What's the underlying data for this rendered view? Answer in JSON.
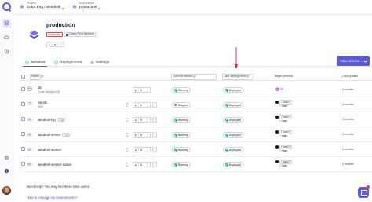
{
  "sidebar": {
    "logo_icon": "qovery-logo-icon",
    "icons": [
      "layers-icon",
      "cloud-icon",
      "history-icon",
      "gear-icon",
      "info-icon"
    ]
  },
  "topbar": {
    "project_caption": "Project",
    "project_value": "Data Eng / Windmill",
    "environment_caption": "Environment",
    "environment_value": "production"
  },
  "environment": {
    "title": "production",
    "mode_tag": "Production",
    "cluster_tag": "Qovery Prod Backend",
    "actions": [
      "▸",
      "↯",
      "⋮"
    ]
  },
  "tabs": [
    {
      "label": "Services",
      "icon": "check-circle-icon",
      "active": true
    },
    {
      "label": "Deployments",
      "icon": "check-circle-icon",
      "active": false
    },
    {
      "label": "Settings",
      "icon": "gear-icon",
      "active": false
    }
  ],
  "new_service_label": "New service",
  "table": {
    "headers": {
      "name": "Name",
      "service_status": "Service status",
      "last_deployment": "Last deployment",
      "target_version": "Target version",
      "last_update": "Last update"
    },
    "rows": [
      {
        "name": "db",
        "sub": "Cloud Managed DB",
        "icon": "database-icon",
        "git": "",
        "status": "Running",
        "status_kind": "ok",
        "deployment": "Deployed",
        "version": [
          "14"
        ],
        "version_kind": "db",
        "update": "4 months"
      },
      {
        "name": "init-db",
        "sub": "Start",
        "icon": "lifecycle-icon",
        "git": "",
        "status": "Stopped",
        "status_kind": "stop",
        "deployment": "Deployed",
        "version": [
          "77de677",
          "main"
        ],
        "version_kind": "git",
        "update": "4 months"
      },
      {
        "name": "windmill-lsp",
        "sub": "",
        "icon": "cloud-app-icon",
        "git": "⑂",
        "status": "Running",
        "status_kind": "ok",
        "deployment": "Deployed",
        "version": [
          "77de677",
          "main"
        ],
        "version_kind": "git",
        "update": "4 months"
      },
      {
        "name": "windmill-server",
        "sub": "",
        "icon": "cloud-app-icon",
        "git": "⑂",
        "status": "Running",
        "status_kind": "ok",
        "deployment": "Deployed",
        "version": [
          "77de677",
          "main"
        ],
        "version_kind": "git",
        "update": "4 months"
      },
      {
        "name": "windmill-worker",
        "sub": "",
        "icon": "cloud-app-icon",
        "git": "",
        "status": "Running",
        "status_kind": "ok",
        "deployment": "Deployed",
        "version": [
          "77de677",
          "main"
        ],
        "version_kind": "git",
        "update": "4 months"
      },
      {
        "name": "windmill-worker-native",
        "sub": "",
        "icon": "cloud-app-icon",
        "git": "",
        "status": "Running",
        "status_kind": "ok",
        "deployment": "Deployed",
        "version": [
          "77de677",
          "main"
        ],
        "version_kind": "git",
        "update": "4 months"
      }
    ]
  },
  "help": {
    "question": "Need help? You may find these links useful",
    "link": "How to manage my environment"
  },
  "colors": {
    "accent": "#5b5bd6",
    "danger": "#ef4444",
    "success": "#10b981"
  }
}
